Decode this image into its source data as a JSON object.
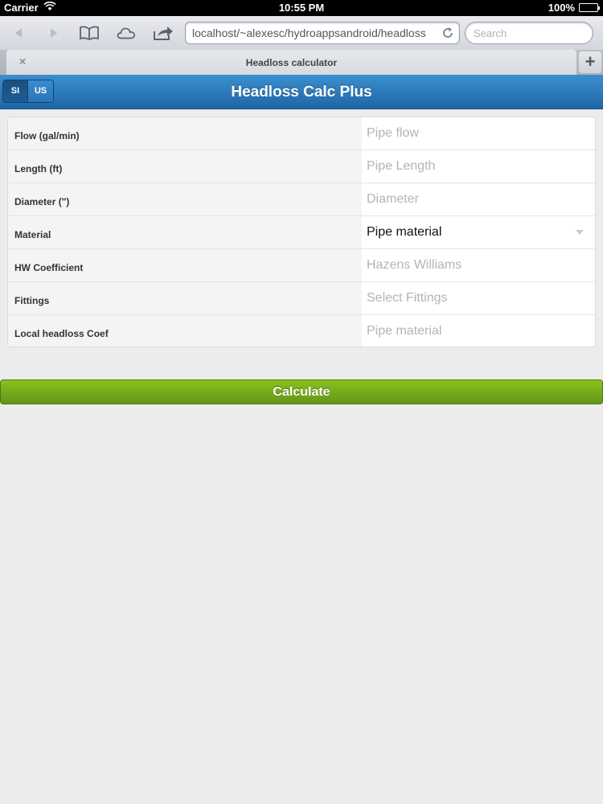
{
  "status_bar": {
    "carrier": "Carrier",
    "time": "10:55 PM",
    "battery": "100%"
  },
  "browser": {
    "url": "localhost/~alexesc/hydroappsandroid/headloss",
    "search_placeholder": "Search",
    "tab_title": "Headloss calculator",
    "tab_close": "×",
    "new_tab": "+"
  },
  "app": {
    "title": "Headloss Calc Plus",
    "units": {
      "si": "SI",
      "us": "US",
      "selected": "SI"
    }
  },
  "form": {
    "rows": [
      {
        "label": "Flow (gal/min)",
        "placeholder": "Pipe flow"
      },
      {
        "label": "Length (ft)",
        "placeholder": "Pipe Length"
      },
      {
        "label": "Diameter (\")",
        "placeholder": "Diameter"
      },
      {
        "label": "Material",
        "value": "Pipe material"
      },
      {
        "label": "HW Coefficient",
        "placeholder": "Hazens Williams"
      },
      {
        "label": "Fittings",
        "placeholder": "Select Fittings"
      },
      {
        "label": "Local headloss Coef",
        "placeholder": "Pipe material"
      }
    ]
  },
  "calculate_label": "Calculate"
}
